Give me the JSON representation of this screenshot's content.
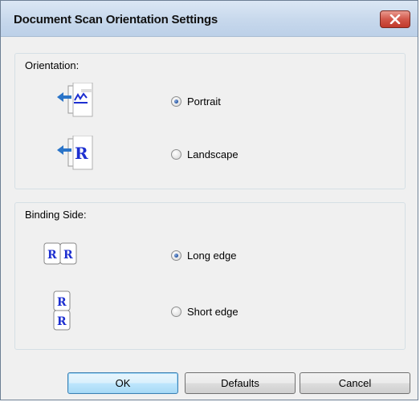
{
  "window": {
    "title": "Document Scan Orientation Settings"
  },
  "orientation": {
    "label": "Orientation:",
    "options": [
      {
        "label": "Portrait",
        "selected": true,
        "icon": "portrait-orientation-icon"
      },
      {
        "label": "Landscape",
        "selected": false,
        "icon": "landscape-orientation-icon"
      }
    ]
  },
  "binding": {
    "label": "Binding Side:",
    "options": [
      {
        "label": "Long edge",
        "selected": true,
        "icon": "long-edge-binding-icon"
      },
      {
        "label": "Short edge",
        "selected": false,
        "icon": "short-edge-binding-icon"
      }
    ]
  },
  "buttons": {
    "ok": "OK",
    "defaults": "Defaults",
    "cancel": "Cancel"
  },
  "colors": {
    "arrow_blue": "#2a74c8",
    "letter_blue": "#1d2fd0",
    "close_red": "#c94c3f"
  }
}
